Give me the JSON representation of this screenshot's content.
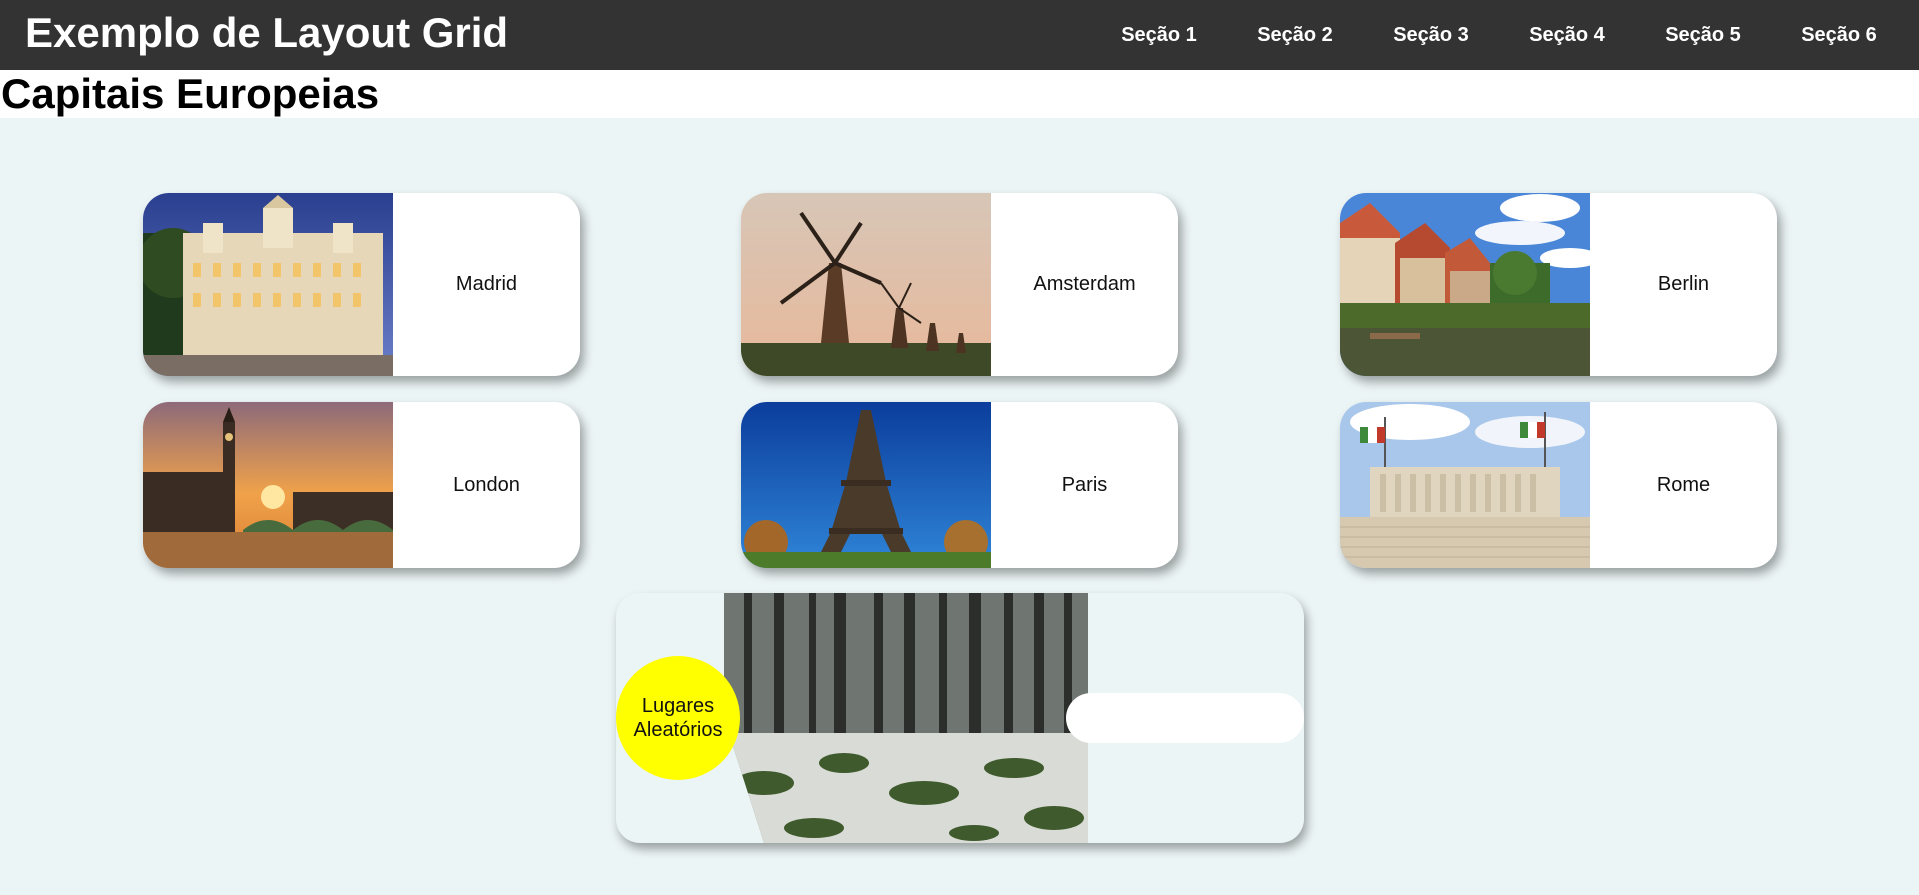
{
  "header": {
    "title": "Exemplo de Layout Grid",
    "nav": [
      "Seção 1",
      "Seção 2",
      "Seção 3",
      "Seção 4",
      "Seção 5",
      "Seção 6"
    ]
  },
  "page": {
    "title": "Capitais Europeias"
  },
  "cities": [
    {
      "name": "Madrid",
      "image": "madrid-palace-photo"
    },
    {
      "name": "Amsterdam",
      "image": "amsterdam-windmills-photo"
    },
    {
      "name": "Berlin",
      "image": "berlin-riverside-houses-photo"
    },
    {
      "name": "London",
      "image": "london-big-ben-photo"
    },
    {
      "name": "Paris",
      "image": "paris-eiffel-tower-photo"
    },
    {
      "name": "Rome",
      "image": "rome-vittoriano-photo"
    }
  ],
  "random": {
    "label_line1": "Lugares",
    "label_line2": "Aleatórios",
    "image": "forest-snow-photo"
  },
  "colors": {
    "header_bg": "#333333",
    "grid_bg": "#ecf5f6",
    "card_bg": "#ffffff",
    "highlight_circle": "#ffff00"
  }
}
